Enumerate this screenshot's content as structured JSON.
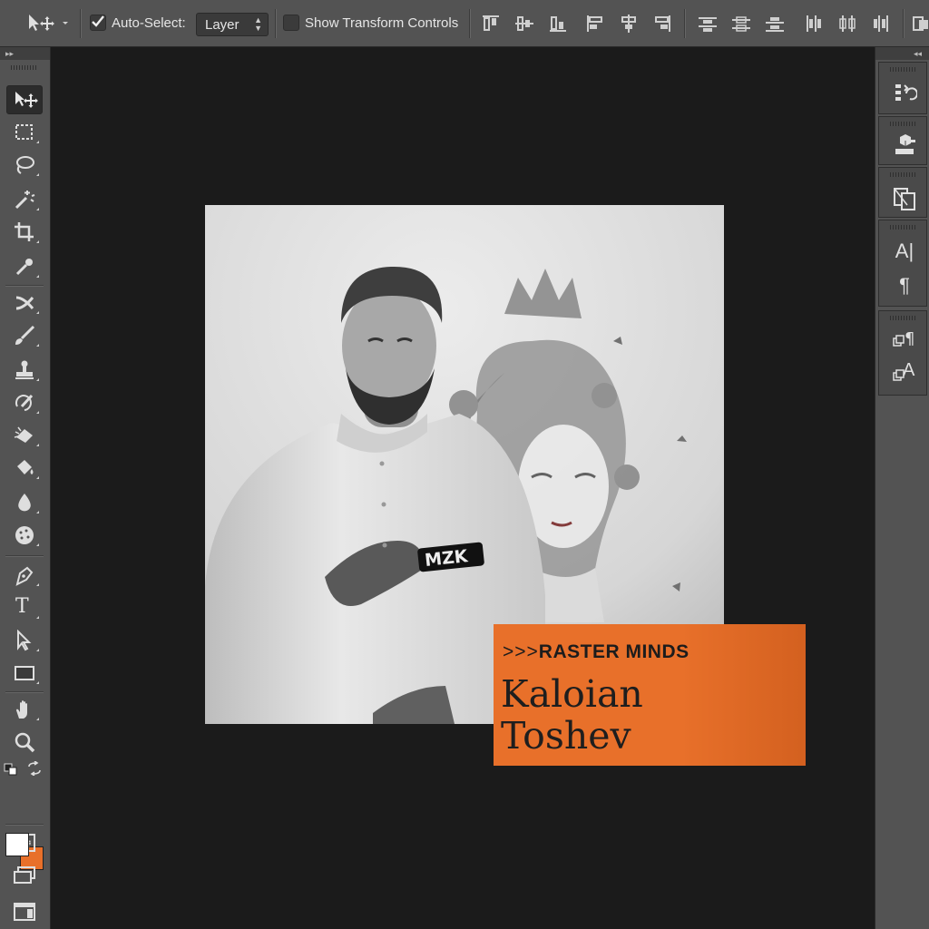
{
  "options_bar": {
    "tool_icon": "move-tool-icon",
    "auto_select_label": "Auto-Select:",
    "auto_select_checked": true,
    "target_value": "Layer",
    "transform_label": "Show Transform Controls",
    "transform_checked": false,
    "align_icons": [
      "align-top-edges-icon",
      "align-vertical-centers-icon",
      "align-bottom-edges-icon",
      "align-left-edges-icon",
      "align-horizontal-centers-icon",
      "align-right-edges-icon",
      "distribute-top-edges-icon",
      "distribute-vertical-centers-icon",
      "distribute-bottom-edges-icon",
      "distribute-left-edges-icon",
      "distribute-horizontal-centers-icon",
      "distribute-right-edges-icon"
    ]
  },
  "toolbar": {
    "tools": [
      "move-tool",
      "marquee-tool",
      "lasso-tool",
      "magic-wand-tool",
      "crop-tool",
      "eyedropper-tool",
      "healing-brush-tool",
      "brush-tool",
      "clone-stamp-tool",
      "history-brush-tool",
      "eraser-tool",
      "paint-bucket-tool",
      "blur-tool",
      "sponge-tool",
      "pen-tool",
      "type-tool",
      "path-selection-tool",
      "rectangle-tool",
      "hand-tool",
      "zoom-tool"
    ],
    "type_tool_glyph": "T",
    "foreground_color": "#ffffff",
    "background_color": "#e8702a"
  },
  "right_panel": {
    "groups": [
      "history-panel",
      "3d-panel",
      "layer-comps-panel",
      "character-panel",
      "character-styles-panel"
    ],
    "character_glyph": "A|",
    "paragraph_glyph": "¶",
    "character_style_glyph": "A"
  },
  "canvas": {
    "photo_description_icon": "portrait-photo",
    "shirt_logo_text": "MZK",
    "accent_color": "#e8702a",
    "brand_arrows": ">>>",
    "brand_name": "RASTER MINDS",
    "person_first_name": "Kaloian",
    "person_last_name": "Toshev"
  }
}
